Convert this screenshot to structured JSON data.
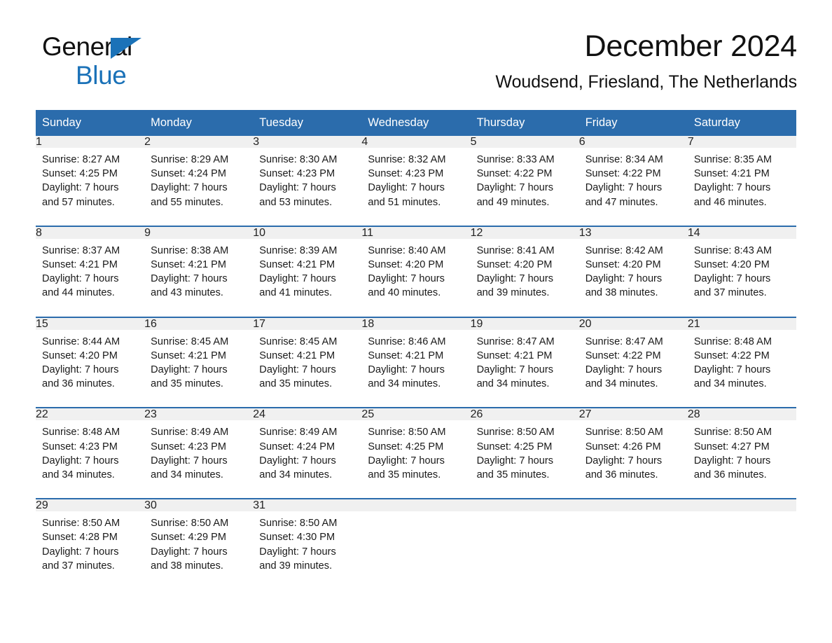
{
  "logo": {
    "word1": "General",
    "word2": "Blue",
    "triangle_color": "#1b72b8"
  },
  "header": {
    "title": "December 2024",
    "subtitle": "Woudsend, Friesland, The Netherlands"
  },
  "theme": {
    "header_blue": "#2b6cac",
    "daynum_band": "#f0f0f0",
    "text": "#1a1a1a"
  },
  "weekday_headers": [
    "Sunday",
    "Monday",
    "Tuesday",
    "Wednesday",
    "Thursday",
    "Friday",
    "Saturday"
  ],
  "weeks": [
    [
      {
        "day": "1",
        "lines": [
          "Sunrise: 8:27 AM",
          "Sunset: 4:25 PM",
          "Daylight: 7 hours",
          "and 57 minutes."
        ]
      },
      {
        "day": "2",
        "lines": [
          "Sunrise: 8:29 AM",
          "Sunset: 4:24 PM",
          "Daylight: 7 hours",
          "and 55 minutes."
        ]
      },
      {
        "day": "3",
        "lines": [
          "Sunrise: 8:30 AM",
          "Sunset: 4:23 PM",
          "Daylight: 7 hours",
          "and 53 minutes."
        ]
      },
      {
        "day": "4",
        "lines": [
          "Sunrise: 8:32 AM",
          "Sunset: 4:23 PM",
          "Daylight: 7 hours",
          "and 51 minutes."
        ]
      },
      {
        "day": "5",
        "lines": [
          "Sunrise: 8:33 AM",
          "Sunset: 4:22 PM",
          "Daylight: 7 hours",
          "and 49 minutes."
        ]
      },
      {
        "day": "6",
        "lines": [
          "Sunrise: 8:34 AM",
          "Sunset: 4:22 PM",
          "Daylight: 7 hours",
          "and 47 minutes."
        ]
      },
      {
        "day": "7",
        "lines": [
          "Sunrise: 8:35 AM",
          "Sunset: 4:21 PM",
          "Daylight: 7 hours",
          "and 46 minutes."
        ]
      }
    ],
    [
      {
        "day": "8",
        "lines": [
          "Sunrise: 8:37 AM",
          "Sunset: 4:21 PM",
          "Daylight: 7 hours",
          "and 44 minutes."
        ]
      },
      {
        "day": "9",
        "lines": [
          "Sunrise: 8:38 AM",
          "Sunset: 4:21 PM",
          "Daylight: 7 hours",
          "and 43 minutes."
        ]
      },
      {
        "day": "10",
        "lines": [
          "Sunrise: 8:39 AM",
          "Sunset: 4:21 PM",
          "Daylight: 7 hours",
          "and 41 minutes."
        ]
      },
      {
        "day": "11",
        "lines": [
          "Sunrise: 8:40 AM",
          "Sunset: 4:20 PM",
          "Daylight: 7 hours",
          "and 40 minutes."
        ]
      },
      {
        "day": "12",
        "lines": [
          "Sunrise: 8:41 AM",
          "Sunset: 4:20 PM",
          "Daylight: 7 hours",
          "and 39 minutes."
        ]
      },
      {
        "day": "13",
        "lines": [
          "Sunrise: 8:42 AM",
          "Sunset: 4:20 PM",
          "Daylight: 7 hours",
          "and 38 minutes."
        ]
      },
      {
        "day": "14",
        "lines": [
          "Sunrise: 8:43 AM",
          "Sunset: 4:20 PM",
          "Daylight: 7 hours",
          "and 37 minutes."
        ]
      }
    ],
    [
      {
        "day": "15",
        "lines": [
          "Sunrise: 8:44 AM",
          "Sunset: 4:20 PM",
          "Daylight: 7 hours",
          "and 36 minutes."
        ]
      },
      {
        "day": "16",
        "lines": [
          "Sunrise: 8:45 AM",
          "Sunset: 4:21 PM",
          "Daylight: 7 hours",
          "and 35 minutes."
        ]
      },
      {
        "day": "17",
        "lines": [
          "Sunrise: 8:45 AM",
          "Sunset: 4:21 PM",
          "Daylight: 7 hours",
          "and 35 minutes."
        ]
      },
      {
        "day": "18",
        "lines": [
          "Sunrise: 8:46 AM",
          "Sunset: 4:21 PM",
          "Daylight: 7 hours",
          "and 34 minutes."
        ]
      },
      {
        "day": "19",
        "lines": [
          "Sunrise: 8:47 AM",
          "Sunset: 4:21 PM",
          "Daylight: 7 hours",
          "and 34 minutes."
        ]
      },
      {
        "day": "20",
        "lines": [
          "Sunrise: 8:47 AM",
          "Sunset: 4:22 PM",
          "Daylight: 7 hours",
          "and 34 minutes."
        ]
      },
      {
        "day": "21",
        "lines": [
          "Sunrise: 8:48 AM",
          "Sunset: 4:22 PM",
          "Daylight: 7 hours",
          "and 34 minutes."
        ]
      }
    ],
    [
      {
        "day": "22",
        "lines": [
          "Sunrise: 8:48 AM",
          "Sunset: 4:23 PM",
          "Daylight: 7 hours",
          "and 34 minutes."
        ]
      },
      {
        "day": "23",
        "lines": [
          "Sunrise: 8:49 AM",
          "Sunset: 4:23 PM",
          "Daylight: 7 hours",
          "and 34 minutes."
        ]
      },
      {
        "day": "24",
        "lines": [
          "Sunrise: 8:49 AM",
          "Sunset: 4:24 PM",
          "Daylight: 7 hours",
          "and 34 minutes."
        ]
      },
      {
        "day": "25",
        "lines": [
          "Sunrise: 8:50 AM",
          "Sunset: 4:25 PM",
          "Daylight: 7 hours",
          "and 35 minutes."
        ]
      },
      {
        "day": "26",
        "lines": [
          "Sunrise: 8:50 AM",
          "Sunset: 4:25 PM",
          "Daylight: 7 hours",
          "and 35 minutes."
        ]
      },
      {
        "day": "27",
        "lines": [
          "Sunrise: 8:50 AM",
          "Sunset: 4:26 PM",
          "Daylight: 7 hours",
          "and 36 minutes."
        ]
      },
      {
        "day": "28",
        "lines": [
          "Sunrise: 8:50 AM",
          "Sunset: 4:27 PM",
          "Daylight: 7 hours",
          "and 36 minutes."
        ]
      }
    ],
    [
      {
        "day": "29",
        "lines": [
          "Sunrise: 8:50 AM",
          "Sunset: 4:28 PM",
          "Daylight: 7 hours",
          "and 37 minutes."
        ]
      },
      {
        "day": "30",
        "lines": [
          "Sunrise: 8:50 AM",
          "Sunset: 4:29 PM",
          "Daylight: 7 hours",
          "and 38 minutes."
        ]
      },
      {
        "day": "31",
        "lines": [
          "Sunrise: 8:50 AM",
          "Sunset: 4:30 PM",
          "Daylight: 7 hours",
          "and 39 minutes."
        ]
      },
      {
        "day": "",
        "lines": []
      },
      {
        "day": "",
        "lines": []
      },
      {
        "day": "",
        "lines": []
      },
      {
        "day": "",
        "lines": []
      }
    ]
  ]
}
